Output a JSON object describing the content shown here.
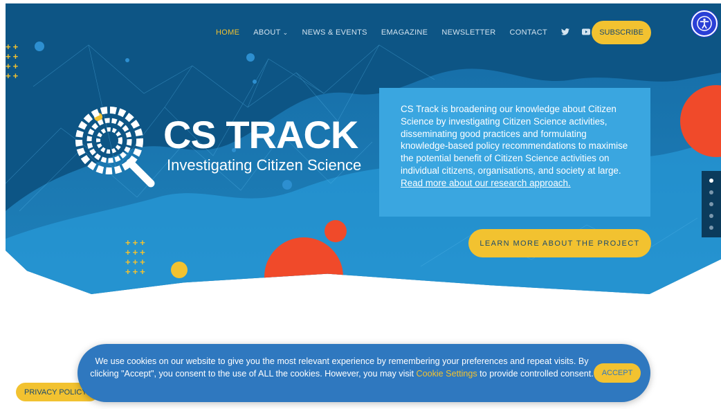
{
  "nav": {
    "items": [
      {
        "label": "HOME",
        "active": true
      },
      {
        "label": "ABOUT",
        "dropdown": true
      },
      {
        "label": "NEWS & EVENTS"
      },
      {
        "label": "EMAGAZINE"
      },
      {
        "label": "NEWSLETTER"
      },
      {
        "label": "CONTACT"
      }
    ],
    "social_icons": [
      "twitter-icon",
      "youtube-icon"
    ],
    "subscribe_label": "SUBSCRIBE"
  },
  "accessibility_icon": "accessibility-icon",
  "logo": {
    "title": "CS TRACK",
    "subtitle": "Investigating Citizen Science"
  },
  "infobox": {
    "text": "CS Track is broadening our knowledge about Citizen Science by investigating Citizen Science activities, disseminating good practices and formulating knowledge-based policy recommendations to maximise the potential benefit of Citizen Science activities on individual citizens, organisations, and society at large. ",
    "link_text": "Read more about our research approach."
  },
  "learn_button_label": "LEARN MORE ABOUT THE PROJECT",
  "slider": {
    "count": 5,
    "active_index": 0
  },
  "cookie": {
    "text_before": "We use cookies on our website to give you the most relevant experience by remembering your preferences and repeat visits. By clicking \"Accept\", you consent to the use of ALL the cookies. However, you may visit ",
    "link_text": "Cookie Settings",
    "text_after": " to provide controlled consent.",
    "accept_label": "ACCEPT"
  },
  "privacy_label": "PRIVACY POLICY",
  "colors": {
    "hero_bg": "#0d5585",
    "accent_yellow": "#f2c230",
    "accent_red": "#f04a2a",
    "infobox_bg": "#3aa6e0",
    "cookie_bg": "#2f78bf"
  }
}
